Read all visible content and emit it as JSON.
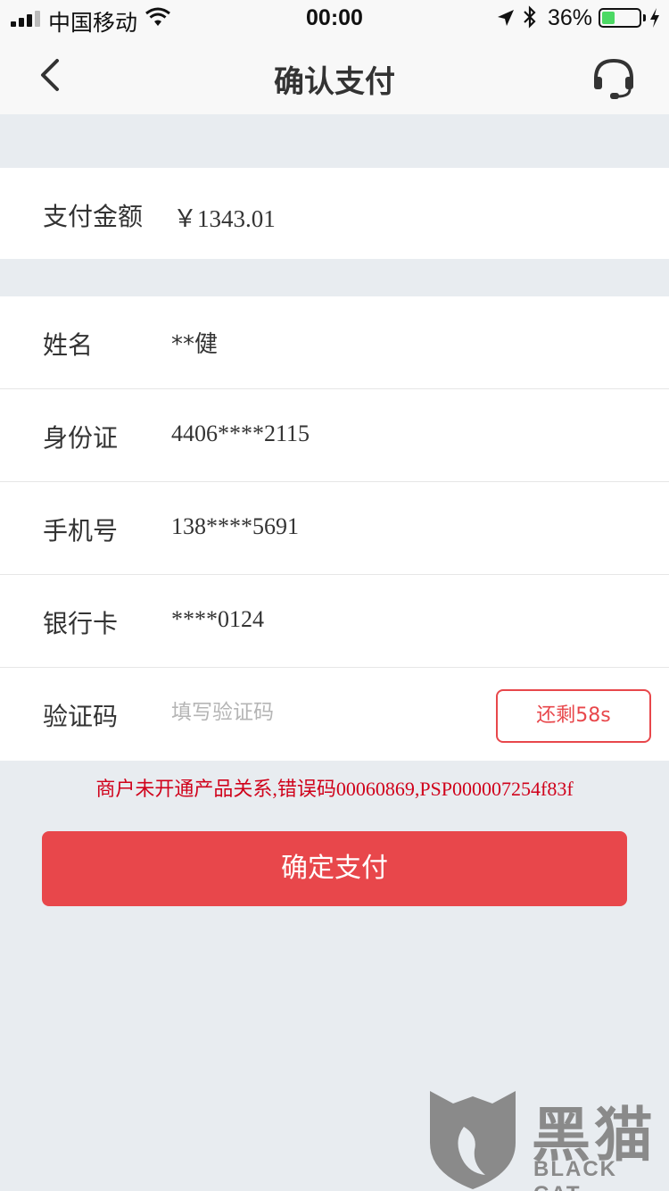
{
  "status_bar": {
    "carrier": "中国移动",
    "time": "00:00",
    "battery_percent": "36%",
    "battery_level": 0.36
  },
  "nav": {
    "title": "确认支付",
    "back_icon": "chevron-left-icon",
    "service_icon": "headset-icon"
  },
  "payment": {
    "amount_label": "支付金额",
    "amount_value": "￥1343.01"
  },
  "fields": {
    "name_label": "姓名",
    "name_value": "**健",
    "id_label": "身份证",
    "id_value": "4406****2115",
    "phone_label": "手机号",
    "phone_value": "138****5691",
    "card_label": "银行卡",
    "card_value": "****0124",
    "code_label": "验证码",
    "code_placeholder": "填写验证码",
    "countdown_label": "还剩58s"
  },
  "error_message": "商户未开通产品关系,错误码00060869,PSP000007254f83f",
  "confirm_label": "确定支付",
  "watermark": {
    "text_cn": "黑猫",
    "text_en": "BLACK CAT"
  },
  "colors": {
    "accent": "#e8474b",
    "error": "#d0021b",
    "background": "#e8ecf0"
  }
}
